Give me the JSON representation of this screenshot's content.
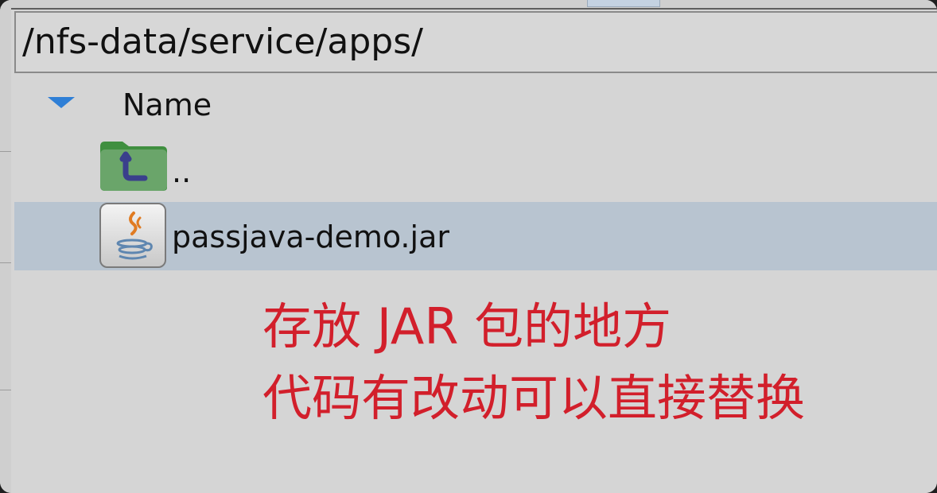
{
  "path_bar": {
    "value": "/nfs-data/service/apps/"
  },
  "file_list": {
    "column_header": "Name",
    "rows": [
      {
        "label": "..",
        "icon": "folder-up-icon",
        "selected": false
      },
      {
        "label": "passjava-demo.jar",
        "icon": "java-jar-icon",
        "selected": true
      }
    ]
  },
  "annotation": {
    "line1": "存放 JAR 包的地方",
    "line2": "代码有改动可以直接替换"
  },
  "colors": {
    "background": "#d5d5d5",
    "selected_row": "#b8c4d0",
    "sort_arrow": "#2f7fd6",
    "folder_green": "#5e9e5e",
    "annotation_red": "#d21f2b"
  }
}
